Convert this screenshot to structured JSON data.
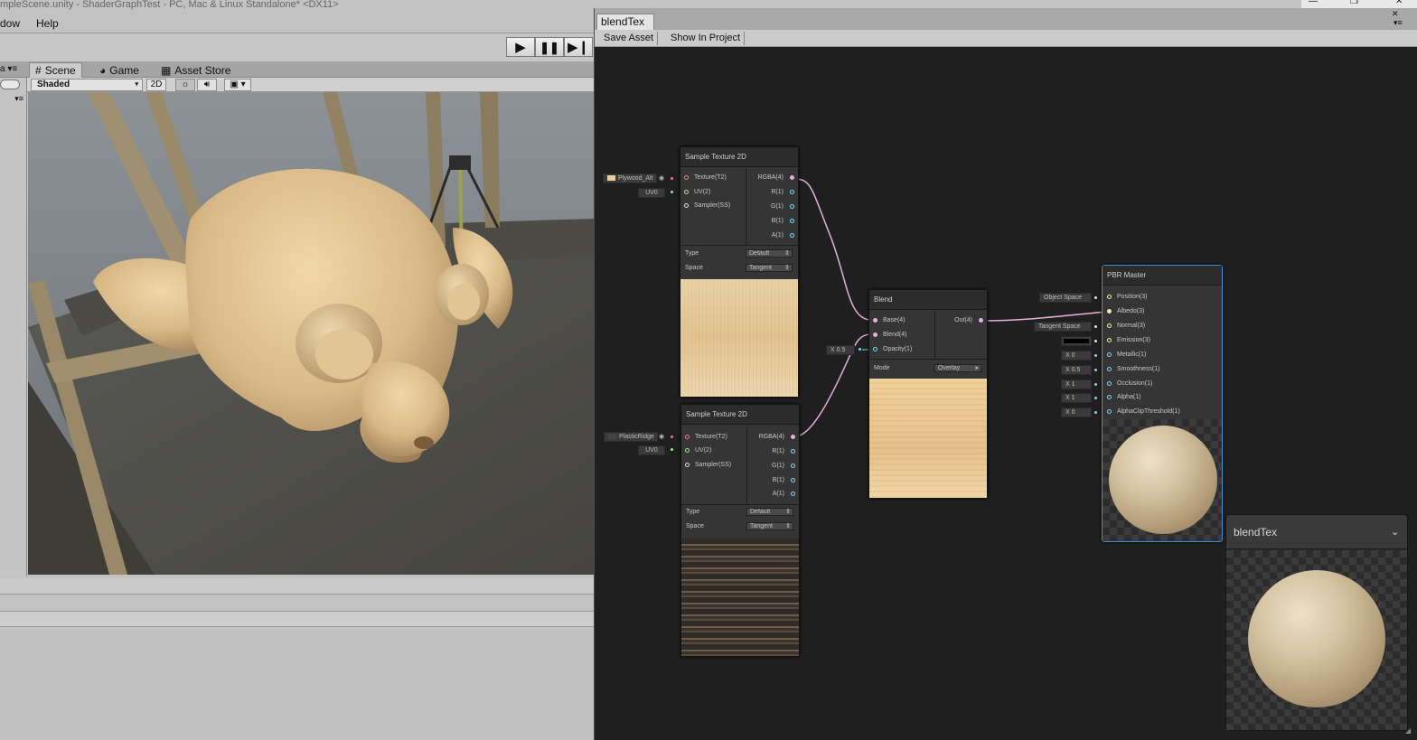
{
  "unity": {
    "title": "mpleScene.unity - ShaderGraphTest - PC, Mac & Linux Standalone* <DX11>",
    "menu": [
      "dow",
      "Help"
    ],
    "tabs": {
      "scene": "Scene",
      "game": "Game",
      "asset_store": "Asset Store"
    },
    "scene_toolbar": {
      "shading_mode": "Shaded",
      "mode_2d": "2D"
    },
    "icons": {
      "play": "play-icon",
      "pause": "pause-icon",
      "step": "step-icon"
    }
  },
  "shader_graph": {
    "tab_title": "blendTex",
    "toolbar": {
      "save": "Save Asset",
      "show": "Show In Project"
    },
    "sample1": {
      "title": "Sample Texture 2D",
      "inputs": [
        "Texture(T2)",
        "UV(2)",
        "Sampler(SS)"
      ],
      "outputs": [
        "RGBA(4)",
        "R(1)",
        "G(1)",
        "B(1)",
        "A(1)"
      ],
      "texture_field": "Plywood_Alt",
      "uv_field": "UV0",
      "type_label": "Type",
      "type_value": "Default",
      "space_label": "Space",
      "space_value": "Tangent"
    },
    "sample2": {
      "title": "Sample Texture 2D",
      "inputs": [
        "Texture(T2)",
        "UV(2)",
        "Sampler(SS)"
      ],
      "outputs": [
        "RGBA(4)",
        "R(1)",
        "G(1)",
        "B(1)",
        "A(1)"
      ],
      "texture_field": "PlasticRidge",
      "uv_field": "UV0",
      "type_label": "Type",
      "type_value": "Default",
      "space_label": "Space",
      "space_value": "Tangent"
    },
    "blend": {
      "title": "Blend",
      "inputs": [
        "Base(4)",
        "Blend(4)",
        "Opacity(1)"
      ],
      "output": "Out(4)",
      "mode_label": "Mode",
      "mode_value": "Overlay",
      "opacity_field": "X  0.5"
    },
    "pbr": {
      "title": "PBR Master",
      "inputs": [
        "Position(3)",
        "Albedo(3)",
        "Normal(3)",
        "Emission(3)",
        "Metallic(1)",
        "Smoothness(1)",
        "Occlusion(1)",
        "Alpha(1)",
        "AlphaClipThreshold(1)"
      ],
      "position_space": "Object Space",
      "normal_space": "Tangent Space",
      "metallic": "X  0",
      "smoothness": "X  0.5",
      "occlusion": "X  1",
      "alpha": "X  1",
      "alpha_clip": "X  0"
    },
    "preview": {
      "title": "blendTex"
    }
  },
  "colors": {
    "port_vector": "#e6b1d8",
    "port_float": "#79d7f2",
    "selected": "#3d8fd6"
  }
}
